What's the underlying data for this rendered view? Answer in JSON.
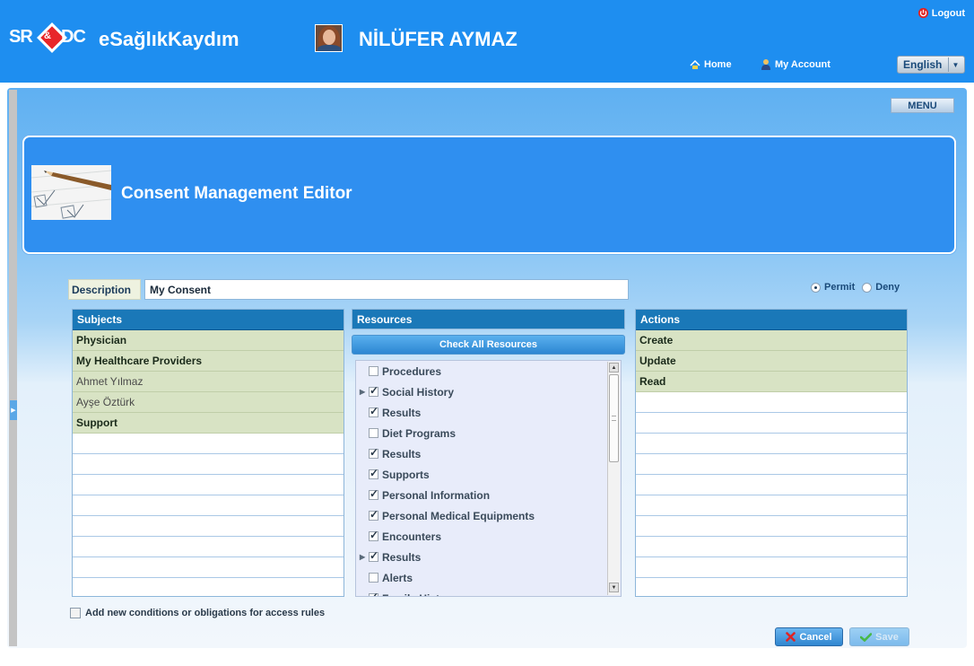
{
  "header": {
    "logo_left": "SR",
    "logo_amp": "&",
    "logo_right": "DC",
    "app_name": "eSağlıkKaydım",
    "user_name": "NİLÜFER AYMAZ",
    "logout_label": "Logout",
    "home_label": "Home",
    "account_label": "My Account",
    "language": "English"
  },
  "menu_label": "MENU",
  "title": "Consent Management Editor",
  "description": {
    "label": "Description",
    "value": "My Consent"
  },
  "effect": {
    "permit_label": "Permit",
    "deny_label": "Deny",
    "selected": "Permit"
  },
  "subjects": {
    "header": "Subjects",
    "items": [
      {
        "label": "Physician"
      },
      {
        "label": "My Healthcare Providers"
      },
      {
        "label": "Ahmet Yılmaz"
      },
      {
        "label": "Ayşe Öztürk"
      },
      {
        "label": "Support"
      }
    ]
  },
  "resources": {
    "header": "Resources",
    "check_all_label": "Check All Resources",
    "items": [
      {
        "label": "Procedures",
        "checked": false,
        "expandable": false
      },
      {
        "label": "Social History",
        "checked": true,
        "expandable": true
      },
      {
        "label": "Results",
        "checked": true,
        "expandable": false
      },
      {
        "label": "Diet Programs",
        "checked": false,
        "expandable": false
      },
      {
        "label": "Results",
        "checked": true,
        "expandable": false
      },
      {
        "label": "Supports",
        "checked": true,
        "expandable": false
      },
      {
        "label": "Personal Information",
        "checked": true,
        "expandable": false
      },
      {
        "label": "Personal Medical Equipments",
        "checked": true,
        "expandable": false
      },
      {
        "label": "Encounters",
        "checked": true,
        "expandable": false
      },
      {
        "label": "Results",
        "checked": true,
        "expandable": true
      },
      {
        "label": "Alerts",
        "checked": false,
        "expandable": false
      },
      {
        "label": "Family History",
        "checked": true,
        "expandable": false
      }
    ]
  },
  "actions": {
    "header": "Actions",
    "items": [
      {
        "label": "Create"
      },
      {
        "label": "Update"
      },
      {
        "label": "Read"
      }
    ]
  },
  "conditions_label": "Add new conditions or obligations for access rules",
  "buttons": {
    "cancel_label": "Cancel",
    "save_label": "Save"
  },
  "colors": {
    "header_blue": "#1e8ef0",
    "panel_header": "#1a78b8",
    "subject_fill": "#d8e3c4",
    "cancel_red": "#d42a2a",
    "save_green": "#48b848"
  }
}
